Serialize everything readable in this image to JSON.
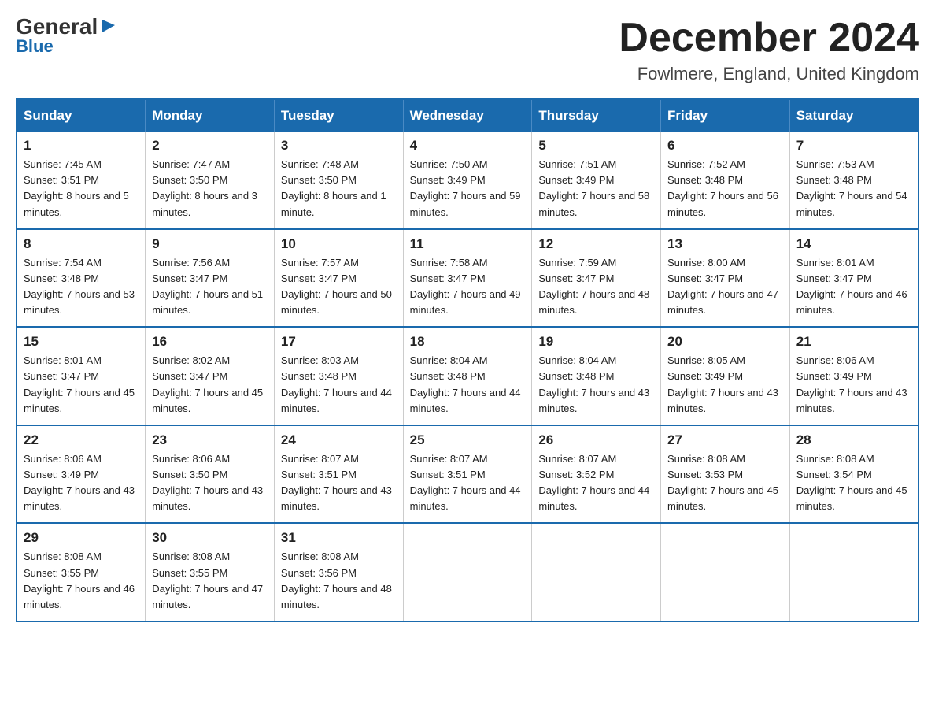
{
  "logo": {
    "general": "General",
    "triangle": "▶",
    "blue": "Blue"
  },
  "header": {
    "month_title": "December 2024",
    "location": "Fowlmere, England, United Kingdom"
  },
  "days_of_week": [
    "Sunday",
    "Monday",
    "Tuesday",
    "Wednesday",
    "Thursday",
    "Friday",
    "Saturday"
  ],
  "weeks": [
    [
      {
        "day": "1",
        "sunrise": "7:45 AM",
        "sunset": "3:51 PM",
        "daylight": "8 hours and 5 minutes."
      },
      {
        "day": "2",
        "sunrise": "7:47 AM",
        "sunset": "3:50 PM",
        "daylight": "8 hours and 3 minutes."
      },
      {
        "day": "3",
        "sunrise": "7:48 AM",
        "sunset": "3:50 PM",
        "daylight": "8 hours and 1 minute."
      },
      {
        "day": "4",
        "sunrise": "7:50 AM",
        "sunset": "3:49 PM",
        "daylight": "7 hours and 59 minutes."
      },
      {
        "day": "5",
        "sunrise": "7:51 AM",
        "sunset": "3:49 PM",
        "daylight": "7 hours and 58 minutes."
      },
      {
        "day": "6",
        "sunrise": "7:52 AM",
        "sunset": "3:48 PM",
        "daylight": "7 hours and 56 minutes."
      },
      {
        "day": "7",
        "sunrise": "7:53 AM",
        "sunset": "3:48 PM",
        "daylight": "7 hours and 54 minutes."
      }
    ],
    [
      {
        "day": "8",
        "sunrise": "7:54 AM",
        "sunset": "3:48 PM",
        "daylight": "7 hours and 53 minutes."
      },
      {
        "day": "9",
        "sunrise": "7:56 AM",
        "sunset": "3:47 PM",
        "daylight": "7 hours and 51 minutes."
      },
      {
        "day": "10",
        "sunrise": "7:57 AM",
        "sunset": "3:47 PM",
        "daylight": "7 hours and 50 minutes."
      },
      {
        "day": "11",
        "sunrise": "7:58 AM",
        "sunset": "3:47 PM",
        "daylight": "7 hours and 49 minutes."
      },
      {
        "day": "12",
        "sunrise": "7:59 AM",
        "sunset": "3:47 PM",
        "daylight": "7 hours and 48 minutes."
      },
      {
        "day": "13",
        "sunrise": "8:00 AM",
        "sunset": "3:47 PM",
        "daylight": "7 hours and 47 minutes."
      },
      {
        "day": "14",
        "sunrise": "8:01 AM",
        "sunset": "3:47 PM",
        "daylight": "7 hours and 46 minutes."
      }
    ],
    [
      {
        "day": "15",
        "sunrise": "8:01 AM",
        "sunset": "3:47 PM",
        "daylight": "7 hours and 45 minutes."
      },
      {
        "day": "16",
        "sunrise": "8:02 AM",
        "sunset": "3:47 PM",
        "daylight": "7 hours and 45 minutes."
      },
      {
        "day": "17",
        "sunrise": "8:03 AM",
        "sunset": "3:48 PM",
        "daylight": "7 hours and 44 minutes."
      },
      {
        "day": "18",
        "sunrise": "8:04 AM",
        "sunset": "3:48 PM",
        "daylight": "7 hours and 44 minutes."
      },
      {
        "day": "19",
        "sunrise": "8:04 AM",
        "sunset": "3:48 PM",
        "daylight": "7 hours and 43 minutes."
      },
      {
        "day": "20",
        "sunrise": "8:05 AM",
        "sunset": "3:49 PM",
        "daylight": "7 hours and 43 minutes."
      },
      {
        "day": "21",
        "sunrise": "8:06 AM",
        "sunset": "3:49 PM",
        "daylight": "7 hours and 43 minutes."
      }
    ],
    [
      {
        "day": "22",
        "sunrise": "8:06 AM",
        "sunset": "3:49 PM",
        "daylight": "7 hours and 43 minutes."
      },
      {
        "day": "23",
        "sunrise": "8:06 AM",
        "sunset": "3:50 PM",
        "daylight": "7 hours and 43 minutes."
      },
      {
        "day": "24",
        "sunrise": "8:07 AM",
        "sunset": "3:51 PM",
        "daylight": "7 hours and 43 minutes."
      },
      {
        "day": "25",
        "sunrise": "8:07 AM",
        "sunset": "3:51 PM",
        "daylight": "7 hours and 44 minutes."
      },
      {
        "day": "26",
        "sunrise": "8:07 AM",
        "sunset": "3:52 PM",
        "daylight": "7 hours and 44 minutes."
      },
      {
        "day": "27",
        "sunrise": "8:08 AM",
        "sunset": "3:53 PM",
        "daylight": "7 hours and 45 minutes."
      },
      {
        "day": "28",
        "sunrise": "8:08 AM",
        "sunset": "3:54 PM",
        "daylight": "7 hours and 45 minutes."
      }
    ],
    [
      {
        "day": "29",
        "sunrise": "8:08 AM",
        "sunset": "3:55 PM",
        "daylight": "7 hours and 46 minutes."
      },
      {
        "day": "30",
        "sunrise": "8:08 AM",
        "sunset": "3:55 PM",
        "daylight": "7 hours and 47 minutes."
      },
      {
        "day": "31",
        "sunrise": "8:08 AM",
        "sunset": "3:56 PM",
        "daylight": "7 hours and 48 minutes."
      },
      null,
      null,
      null,
      null
    ]
  ]
}
